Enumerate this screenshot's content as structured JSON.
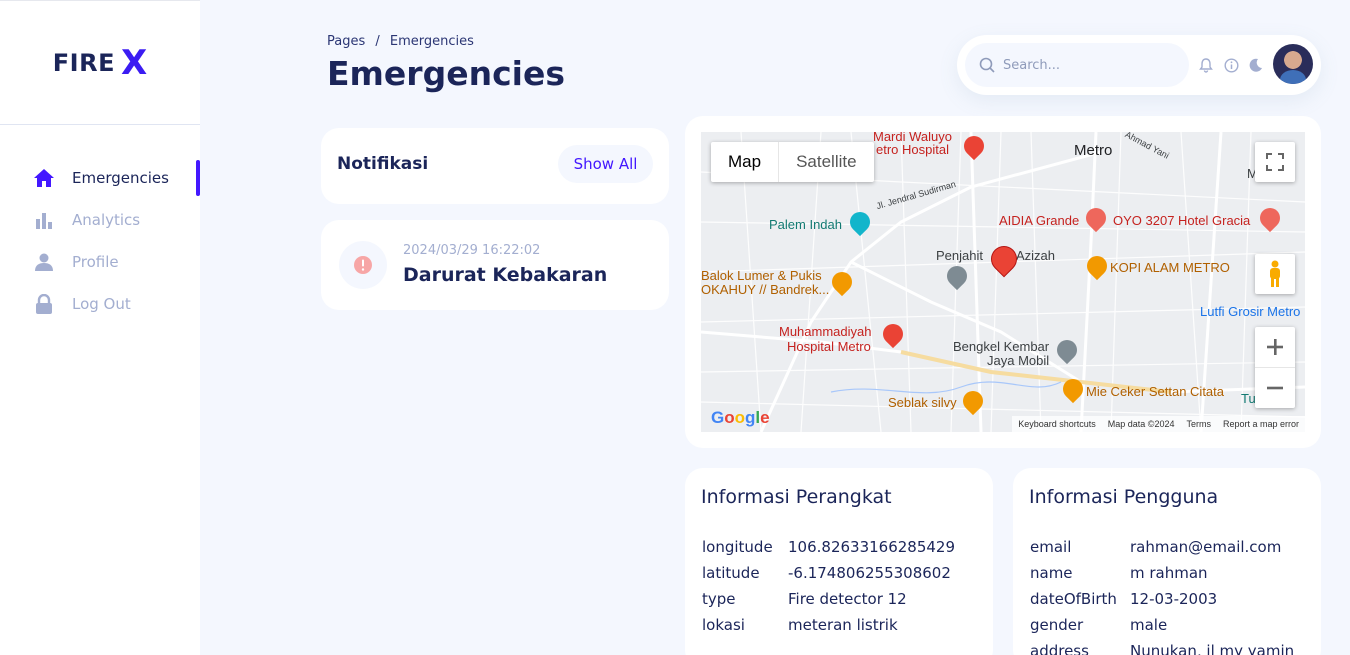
{
  "brand": {
    "name": "FIRE",
    "mark": "X"
  },
  "sidebar": {
    "items": [
      {
        "label": "Emergencies"
      },
      {
        "label": "Analytics"
      },
      {
        "label": "Profile"
      },
      {
        "label": "Log Out"
      }
    ]
  },
  "header": {
    "breadcrumb_root": "Pages",
    "breadcrumb_sep": "/",
    "breadcrumb_current": "Emergencies",
    "title": "Emergencies",
    "search_placeholder": "Search..."
  },
  "notifications": {
    "title": "Notifikasi",
    "show_all": "Show All",
    "items": [
      {
        "time": "2024/03/29 16:22:02",
        "title": "Darurat Kebakaran"
      }
    ]
  },
  "map": {
    "type_map": "Map",
    "type_satellite": "Satellite",
    "labels": {
      "metro": "Metro",
      "mardi1": "Mardi Waluyo",
      "mardi2": "etro Hospital",
      "palem": "Palem Indah",
      "aidia": "AIDIA Grande",
      "oyo": "OYO 3207 Hotel Gracia",
      "muham": "Muham",
      "penjahit": "Penjahit",
      "azizah": "Azizah",
      "kopi": "KOPI ALAM METRO",
      "balok1": "Balok Lumer & Pukis",
      "balok2": "OKAHUY // Bandrek...",
      "lutfi": "Lutfi Grosir Metro",
      "muhammadiyah1": "Muhammadiyah",
      "muhammadiyah2": "Hospital Metro",
      "bengkel1": "Bengkel Kembar",
      "bengkel2": "Jaya Mobil",
      "mie": "Mie Ceker Settan Citata",
      "seblak": "Seblak silvy",
      "tu": "Tu",
      "sudirman": "Jl. Jendral Sudirman",
      "ahmad": "Ahmad Yani"
    },
    "google": "Google",
    "footer": [
      "Keyboard shortcuts",
      "Map data ©2024",
      "Terms",
      "Report a map error"
    ]
  },
  "device_info": {
    "title": "Informasi Perangkat",
    "rows": [
      {
        "key": "longitude",
        "value": "106.82633166285429"
      },
      {
        "key": "latitude",
        "value": "-6.174806255308602"
      },
      {
        "key": "type",
        "value": "Fire detector 12"
      },
      {
        "key": "lokasi",
        "value": "meteran listrik"
      }
    ]
  },
  "user_info": {
    "title": "Informasi Pengguna",
    "rows": [
      {
        "key": "email",
        "value": "rahman@email.com"
      },
      {
        "key": "name",
        "value": "m rahman"
      },
      {
        "key": "dateOfBirth",
        "value": "12-03-2003"
      },
      {
        "key": "gender",
        "value": "male"
      },
      {
        "key": "address",
        "value": "Nunukan, jl my yamin"
      }
    ]
  }
}
